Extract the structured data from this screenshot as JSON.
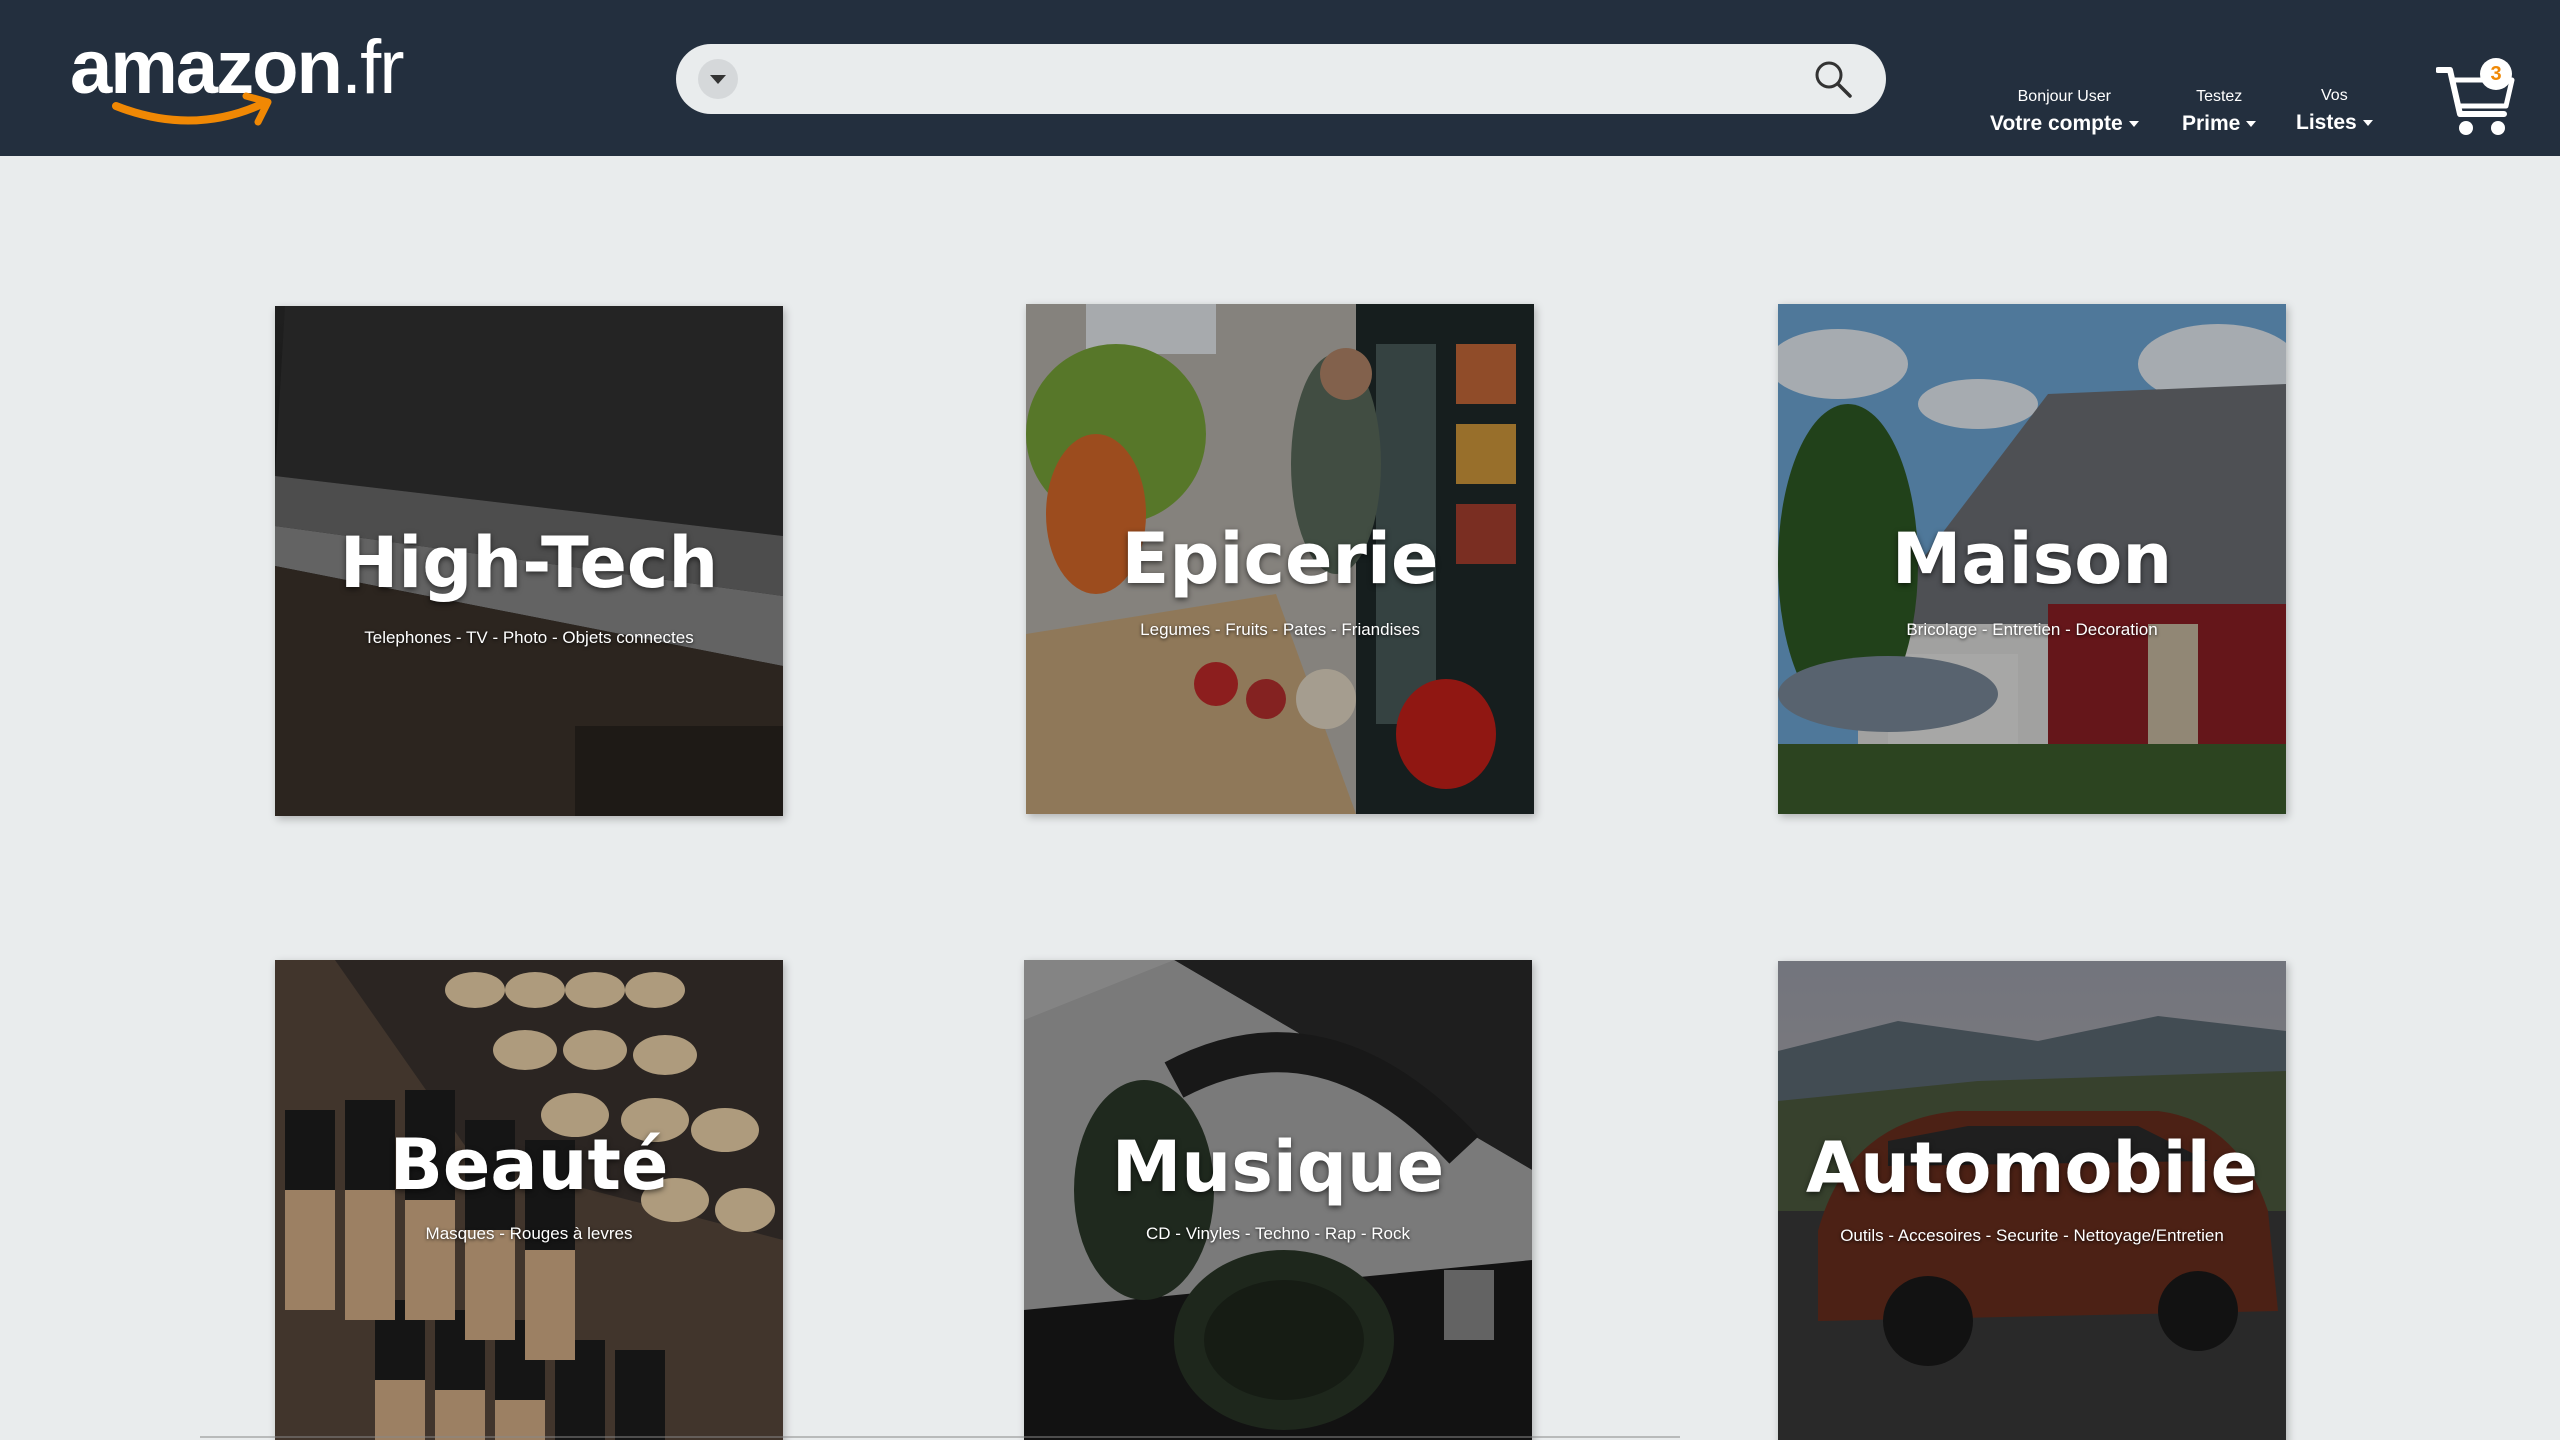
{
  "header": {
    "logo_main": "amazon",
    "logo_tld": ".fr",
    "search": {
      "placeholder": "",
      "value": ""
    },
    "account": {
      "small": "Bonjour User",
      "big": "Votre compte"
    },
    "prime": {
      "small": "Testez",
      "big": "Prime"
    },
    "lists": {
      "small": "Vos",
      "big": "Listes"
    },
    "cart_count": "3"
  },
  "colors": {
    "header_bg": "#232f3e",
    "page_bg": "#e9eced",
    "accent": "#f08804"
  },
  "categories": [
    {
      "title": "High-Tech",
      "subtitle": "Telephones - TV - Photo - Objets connectes"
    },
    {
      "title": "Epicerie",
      "subtitle": "Legumes - Fruits - Pates - Friandises"
    },
    {
      "title": "Maison",
      "subtitle": "Bricolage - Entretien - Decoration"
    },
    {
      "title": "Beauté",
      "subtitle": "Masques - Rouges à levres"
    },
    {
      "title": "Musique",
      "subtitle": "CD - Vinyles - Techno - Rap - Rock"
    },
    {
      "title": "Automobile",
      "subtitle": "Outils - Accesoires - Securite - Nettoyage/Entretien"
    }
  ]
}
